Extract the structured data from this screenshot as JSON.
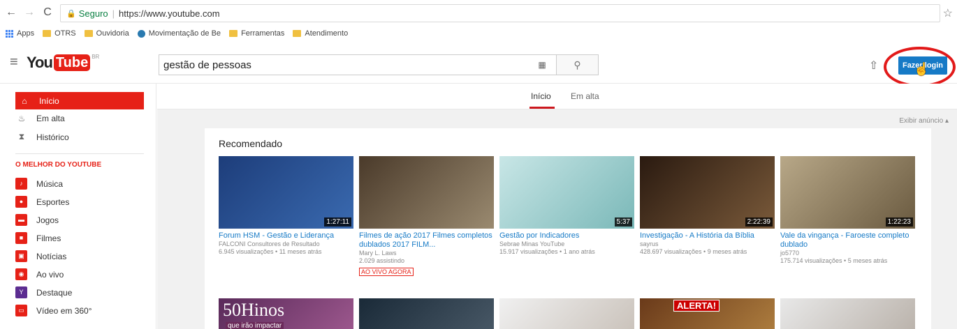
{
  "browser": {
    "secure_label": "Seguro",
    "url": "https://www.youtube.com",
    "bookmarks": [
      "Apps",
      "OTRS",
      "Ouvidoria",
      "Movimentação de Be",
      "Ferramentas",
      "Atendimento"
    ]
  },
  "header": {
    "logo_you": "You",
    "logo_tube": "Tube",
    "logo_region": "BR",
    "search_value": "gestão de pessoas",
    "login_label": "Fazer login"
  },
  "sidebar": {
    "items": [
      {
        "label": "Início",
        "icon": "home-icon"
      },
      {
        "label": "Em alta",
        "icon": "flame-icon"
      },
      {
        "label": "Histórico",
        "icon": "hourglass-icon"
      }
    ],
    "section_heading": "O MELHOR DO YOUTUBE",
    "channels": [
      {
        "label": "Música",
        "color": "#e62117"
      },
      {
        "label": "Esportes",
        "color": "#e62117"
      },
      {
        "label": "Jogos",
        "color": "#e62117"
      },
      {
        "label": "Filmes",
        "color": "#e62117"
      },
      {
        "label": "Notícias",
        "color": "#e62117"
      },
      {
        "label": "Ao vivo",
        "color": "#e62117"
      },
      {
        "label": "Destaque",
        "color": "#5c2d91"
      },
      {
        "label": "Vídeo em 360°",
        "color": "#e62117"
      }
    ]
  },
  "main": {
    "tabs": [
      "Início",
      "Em alta"
    ],
    "ad_toggle": "Exibir anúncio ▴",
    "section_title": "Recomendado",
    "videos": [
      {
        "title": "Forum HSM - Gestão e Liderança",
        "channel": "FALCONI Consultores de Resultado",
        "meta": "6.945 visualizações • 11 meses atrás",
        "duration": "1:27:11",
        "color": "#2a4a8a"
      },
      {
        "title": "Filmes de ação 2017 Filmes completos dublados 2017 FILM...",
        "channel": "Mary L. Laws",
        "meta": "2.029 assistindo",
        "badge": "AO VIVO AGORA",
        "color": "#6a5a48"
      },
      {
        "title": "Gestão por Indicadores",
        "channel": "Sebrae Minas YouTube",
        "meta": "15.917 visualizações • 1 ano atrás",
        "duration": "5:37",
        "color": "#9ed0d0"
      },
      {
        "title": "Investigação - A História da Bíblia",
        "channel": "sayrus",
        "meta": "428.697 visualizações • 9 meses atrás",
        "duration": "2:22:39",
        "color": "#4a3a2a"
      },
      {
        "title": "Vale da vingança - Faroeste completo dublado",
        "channel": "jo5770",
        "meta": "175.714 visualizações • 5 meses atrás",
        "duration": "1:22:23",
        "color": "#8a7a60"
      }
    ],
    "row2": [
      {
        "caption": "50Hinos",
        "sub": "que irão impactar",
        "color": "#7a3a6a"
      },
      {
        "color": "#2a3a48"
      },
      {
        "color": "#e8e8e8"
      },
      {
        "caption": "ALERTA!",
        "color": "#8a5a2a"
      },
      {
        "color": "#e0e0e0"
      }
    ]
  }
}
